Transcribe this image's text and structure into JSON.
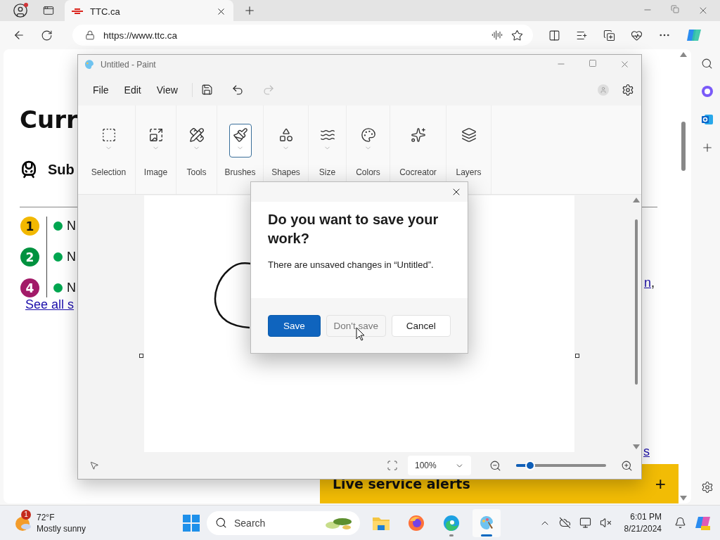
{
  "browser": {
    "tabs": [
      {
        "title": "TTC.ca",
        "selected": true
      }
    ],
    "url": "https://www.ttc.ca"
  },
  "page": {
    "heading": "Curr",
    "section_title": "Sub",
    "lines": [
      {
        "number": "1",
        "color": "#f2b800",
        "name": "N"
      },
      {
        "number": "2",
        "color": "#00923f",
        "name": "N"
      },
      {
        "number": "4",
        "color": "#a21a68",
        "name": "N"
      }
    ],
    "see_all_link": "See all s",
    "side_link": "n",
    "side_punct": ",",
    "bottom_link": "s",
    "alert_bar": {
      "title": "Live service alerts",
      "action": "+"
    }
  },
  "paint": {
    "title": "Untitled - Paint",
    "menus": [
      "File",
      "Edit",
      "View"
    ],
    "tools": [
      {
        "label": "Selection",
        "selected": false,
        "dropdown": true
      },
      {
        "label": "Image",
        "selected": false,
        "dropdown": true
      },
      {
        "label": "Tools",
        "selected": false,
        "dropdown": true
      },
      {
        "label": "Brushes",
        "selected": true,
        "dropdown": true
      },
      {
        "label": "Shapes",
        "selected": false,
        "dropdown": true
      },
      {
        "label": "Size",
        "selected": false,
        "dropdown": true
      },
      {
        "label": "Colors",
        "selected": false,
        "dropdown": true
      },
      {
        "label": "Cocreator",
        "selected": false,
        "dropdown": false
      },
      {
        "label": "Layers",
        "selected": false,
        "dropdown": false
      }
    ],
    "zoom": {
      "value": "100%",
      "level": 0.16
    }
  },
  "dialog": {
    "title": "Do you want to save your work?",
    "message": "There are unsaved changes in “Untitled”.",
    "buttons": [
      {
        "label": "Save",
        "kind": "primary",
        "hovered": false
      },
      {
        "label": "Don't save",
        "kind": "secondary",
        "hovered": true
      },
      {
        "label": "Cancel",
        "kind": "secondary",
        "hovered": false
      }
    ]
  },
  "taskbar": {
    "weather": {
      "badge": "1",
      "temperature": "72°F",
      "condition": "Mostly sunny"
    },
    "search_placeholder": "Search",
    "apps": [
      {
        "kind": "explorer",
        "running": false,
        "active": false
      },
      {
        "kind": "firefox",
        "running": false,
        "active": false
      },
      {
        "kind": "edge",
        "running": true,
        "active": false
      },
      {
        "kind": "paint",
        "running": true,
        "active": true
      }
    ],
    "clock": {
      "time": "6:01 PM",
      "date": "8/21/2024"
    }
  }
}
